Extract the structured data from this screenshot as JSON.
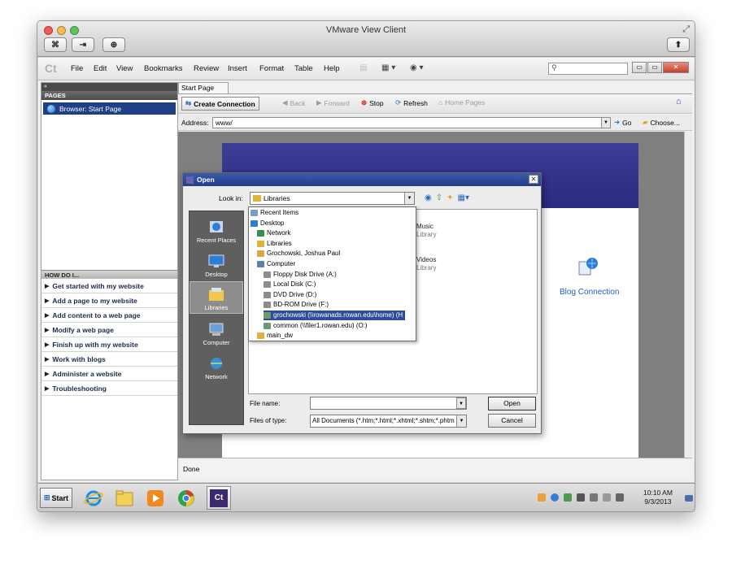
{
  "mac_window": {
    "title": "VMware View Client"
  },
  "menubar": {
    "logo": "Ct",
    "items": [
      "File",
      "Edit",
      "View",
      "Bookmarks",
      "Review",
      "Insert",
      "Format",
      "Table",
      "Help"
    ]
  },
  "left_pane": {
    "pages_header": "PAGES",
    "pages": [
      "Browser: Start Page"
    ],
    "howdo_header": "HOW DO I...",
    "howdo_items": [
      "Get started with my website",
      "Add a page to my website",
      "Add content to a web page",
      "Modify a web page",
      "Finish up with my website",
      "Work with blogs",
      "Administer a website",
      "Troubleshooting"
    ]
  },
  "main": {
    "tab": "Start Page",
    "nav": {
      "create_connection": "Create Connection",
      "back": "Back",
      "forward": "Forward",
      "stop": "Stop",
      "refresh": "Refresh",
      "home_pages": "Home Pages"
    },
    "address_label": "Address:",
    "address_value": "www/",
    "go": "Go",
    "choose": "Choose...",
    "blog_connection": "Blog Connection",
    "status": "Done"
  },
  "dialog": {
    "title": "Open",
    "look_in_label": "Look in:",
    "look_in_value": "Libraries",
    "places": [
      "Recent Places",
      "Desktop",
      "Libraries",
      "Computer",
      "Network"
    ],
    "background_items": [
      {
        "name": "Music",
        "kind": "Library"
      },
      {
        "name": "Videos",
        "kind": "Library"
      }
    ],
    "file_name_label": "File name:",
    "file_name_value": "",
    "files_of_type_label": "Files of type:",
    "files_of_type_value": "All Documents (*.htm;*.html;*.xhtml;*.shtm;*.phtm",
    "open_button": "Open",
    "cancel_button": "Cancel",
    "dropdown_items": [
      {
        "label": "Recent Items",
        "indent": 0,
        "icon": "recent-items-icon",
        "color": "#7a9cc8"
      },
      {
        "label": "Desktop",
        "indent": 0,
        "icon": "desktop-icon",
        "color": "#2f7fd3"
      },
      {
        "label": "Network",
        "indent": 1,
        "icon": "network-icon",
        "color": "#3a8e4a"
      },
      {
        "label": "Libraries",
        "indent": 1,
        "icon": "library-icon",
        "color": "#e0b23a"
      },
      {
        "label": "Grochowski, Joshua Paul",
        "indent": 1,
        "icon": "user-folder-icon",
        "color": "#d9a64a"
      },
      {
        "label": "Computer",
        "indent": 1,
        "icon": "computer-icon",
        "color": "#5a7fb0"
      },
      {
        "label": "Floppy Disk Drive (A:)",
        "indent": 2,
        "icon": "floppy-icon",
        "color": "#8c8c8c"
      },
      {
        "label": "Local Disk (C:)",
        "indent": 2,
        "icon": "disk-icon",
        "color": "#8c8c8c"
      },
      {
        "label": "DVD Drive (D:)",
        "indent": 2,
        "icon": "dvd-icon",
        "color": "#8c8c8c"
      },
      {
        "label": "BD-ROM Drive (F:)",
        "indent": 2,
        "icon": "bdrom-icon",
        "color": "#8c8c8c"
      },
      {
        "label": "grochowski (\\\\rowanads.rowan.edu\\home) (H",
        "indent": 2,
        "icon": "network-drive-icon",
        "color": "#6c9b6c",
        "selected": true
      },
      {
        "label": "common (\\\\filer1.rowan.edu) (O:)",
        "indent": 2,
        "icon": "network-drive-icon",
        "color": "#6c9b6c"
      },
      {
        "label": "main_dw",
        "indent": 1,
        "icon": "folder-icon",
        "color": "#e0b23a"
      }
    ]
  },
  "taskbar": {
    "start": "Start",
    "active_app": "Ct",
    "clock_time": "10:10 AM",
    "clock_date": "9/3/2013"
  }
}
